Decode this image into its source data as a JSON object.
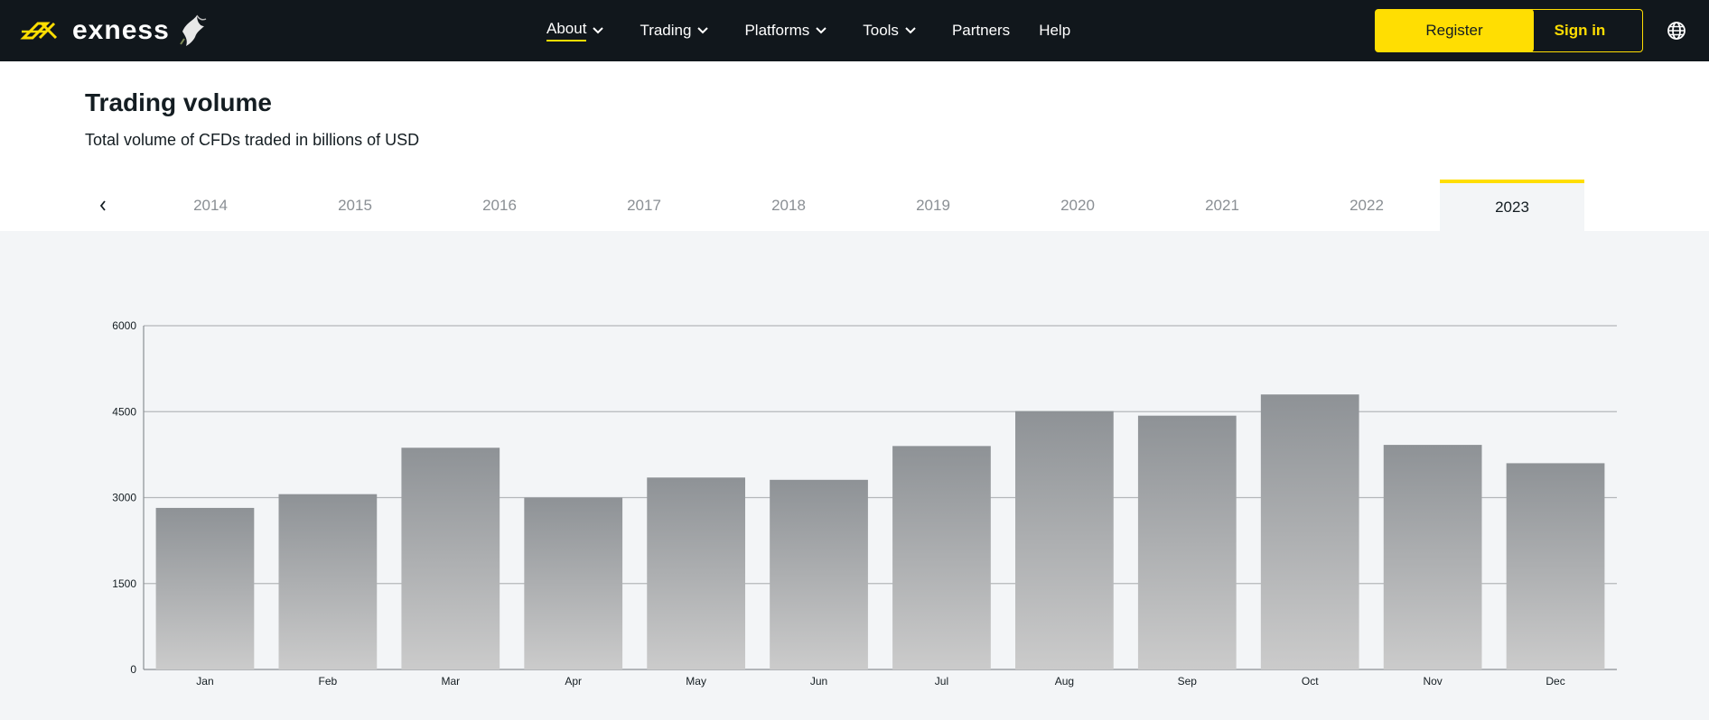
{
  "header": {
    "brand": "exness",
    "nav": [
      {
        "label": "About",
        "has_dropdown": true,
        "active": true
      },
      {
        "label": "Trading",
        "has_dropdown": true,
        "active": false
      },
      {
        "label": "Platforms",
        "has_dropdown": true,
        "active": false
      },
      {
        "label": "Tools",
        "has_dropdown": true,
        "active": false
      },
      {
        "label": "Partners",
        "has_dropdown": false,
        "active": false
      },
      {
        "label": "Help",
        "has_dropdown": false,
        "active": false
      }
    ],
    "register_label": "Register",
    "signin_label": "Sign in",
    "globe_icon": "globe-icon",
    "colors": {
      "bar": "#11171c",
      "accent": "#ffde02"
    }
  },
  "section": {
    "title": "Trading volume",
    "subtitle": "Total volume of CFDs traded in billions of USD"
  },
  "years": {
    "tabs": [
      "2014",
      "2015",
      "2016",
      "2017",
      "2018",
      "2019",
      "2020",
      "2021",
      "2022",
      "2023"
    ],
    "selected": "2023",
    "prev_icon": "chevron-left-icon"
  },
  "chart_data": {
    "type": "bar",
    "categories": [
      "Jan",
      "Feb",
      "Mar",
      "Apr",
      "May",
      "Jun",
      "Jul",
      "Aug",
      "Sep",
      "Oct",
      "Nov",
      "Dec"
    ],
    "values": [
      2820,
      3060,
      3870,
      3000,
      3350,
      3310,
      3900,
      4510,
      4430,
      4800,
      3920,
      3600
    ],
    "yticks": [
      0,
      1500,
      3000,
      4500,
      6000
    ],
    "ylim": [
      0,
      6000
    ],
    "grid": true,
    "bar_gradient": [
      "#8e9296",
      "#cbcbcb"
    ]
  }
}
